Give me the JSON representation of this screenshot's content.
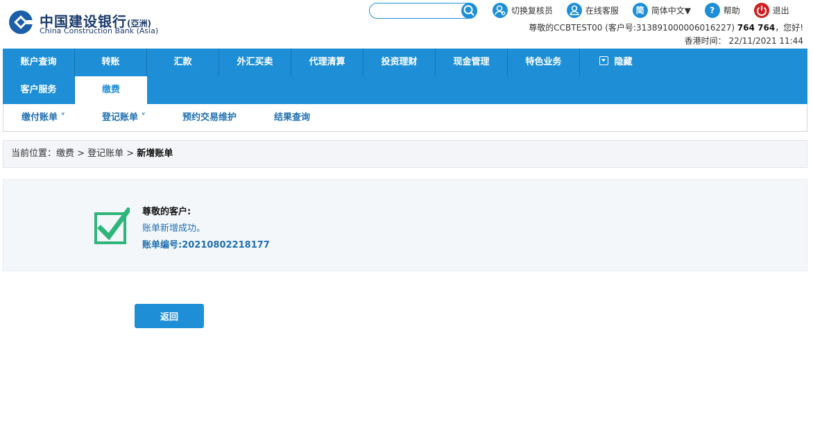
{
  "brand": {
    "name_cn": "中国建设银行",
    "region_cn": "(亞洲)",
    "name_en": "China Construction Bank (Asia)"
  },
  "search": {
    "placeholder": ""
  },
  "top_links": [
    {
      "label": "切换复核员",
      "icon": "user-switch-icon"
    },
    {
      "label": "在线客服",
      "icon": "user-icon"
    },
    {
      "label": "简体中文▼",
      "icon": "simplified-chinese-icon",
      "glyph": "简"
    },
    {
      "label": "帮助",
      "icon": "help-icon",
      "glyph": "?"
    },
    {
      "label": "退出",
      "icon": "power-icon"
    }
  ],
  "greeting": {
    "prefix": "尊敬的CCBTEST00 (客户号:313891000006016227)",
    "name": "764 764",
    "suffix": "，您好!"
  },
  "clock": {
    "label": "香港时间：",
    "value": "22/11/2021 11:44"
  },
  "nav": {
    "row1": [
      "账户查询",
      "转账",
      "汇款",
      "外汇买卖",
      "代理清算",
      "投资理财",
      "现金管理",
      "特色业务",
      "隐藏"
    ],
    "row2": [
      "客户服务",
      "缴费"
    ],
    "active": "缴费"
  },
  "subnav": [
    "缴付账单 ˅",
    "登记账单 ˅",
    "预约交易维护",
    "结果查询"
  ],
  "breadcrumb": {
    "prefix": "当前位置：缴费 > 登记账单 > ",
    "current": "新增账单"
  },
  "result": {
    "title": "尊敬的客户:",
    "message": "账单新增成功。",
    "bill_no": "账单编号:20210802218177"
  },
  "back_button": "返回",
  "colors": {
    "primary": "#1e8fd6",
    "success": "#2fb57a",
    "danger": "#cc1f1f"
  }
}
